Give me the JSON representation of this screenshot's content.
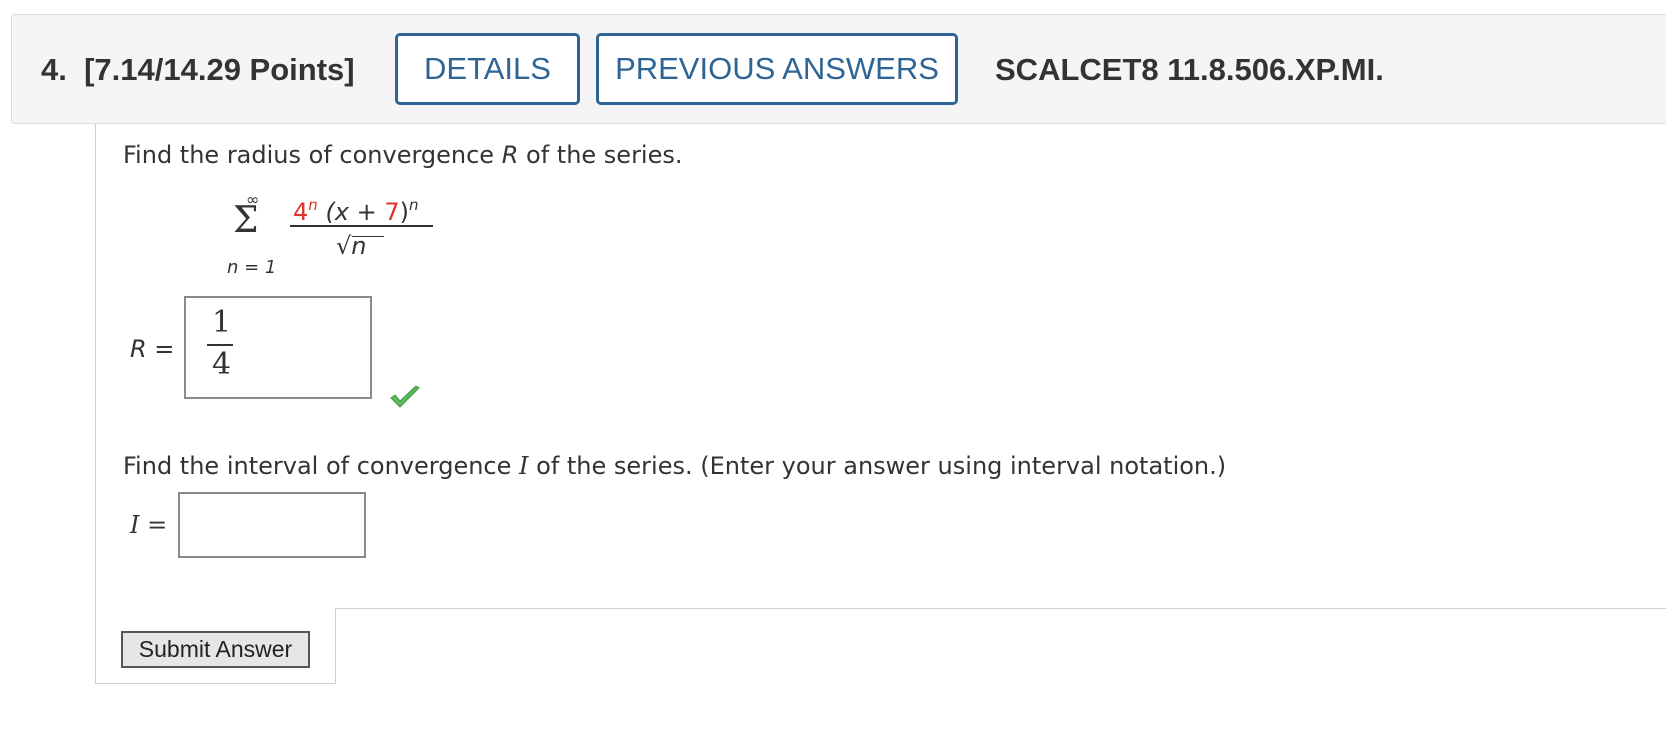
{
  "header": {
    "question_number": "4.",
    "points": "[7.14/14.29 Points]",
    "details_label": "DETAILS",
    "previous_answers_label": "PREVIOUS ANSWERS",
    "question_code": "SCALCET8 11.8.506.XP.MI."
  },
  "question": {
    "prompt1_a": "Find the radius of convergence ",
    "prompt1_var": "R",
    "prompt1_b": " of the series.",
    "series": {
      "upper": "∞",
      "lower": "n = 1",
      "coef": "4",
      "exp": "n",
      "open": "(x + ",
      "shift": "7",
      "close": ")",
      "denom_var": "n"
    },
    "r_label": "R =",
    "r_answer": {
      "numerator": "1",
      "denominator": "4"
    },
    "r_status": "correct",
    "prompt2_a": "Find the interval of convergence ",
    "prompt2_var": "I",
    "prompt2_b": " of the series. (Enter your answer using interval notation.)",
    "i_label": "I =",
    "i_answer": ""
  },
  "submit_label": "Submit Answer",
  "colors": {
    "accent": "#2f6596",
    "highlight": "#e0302a",
    "correct": "#5cb85c"
  }
}
